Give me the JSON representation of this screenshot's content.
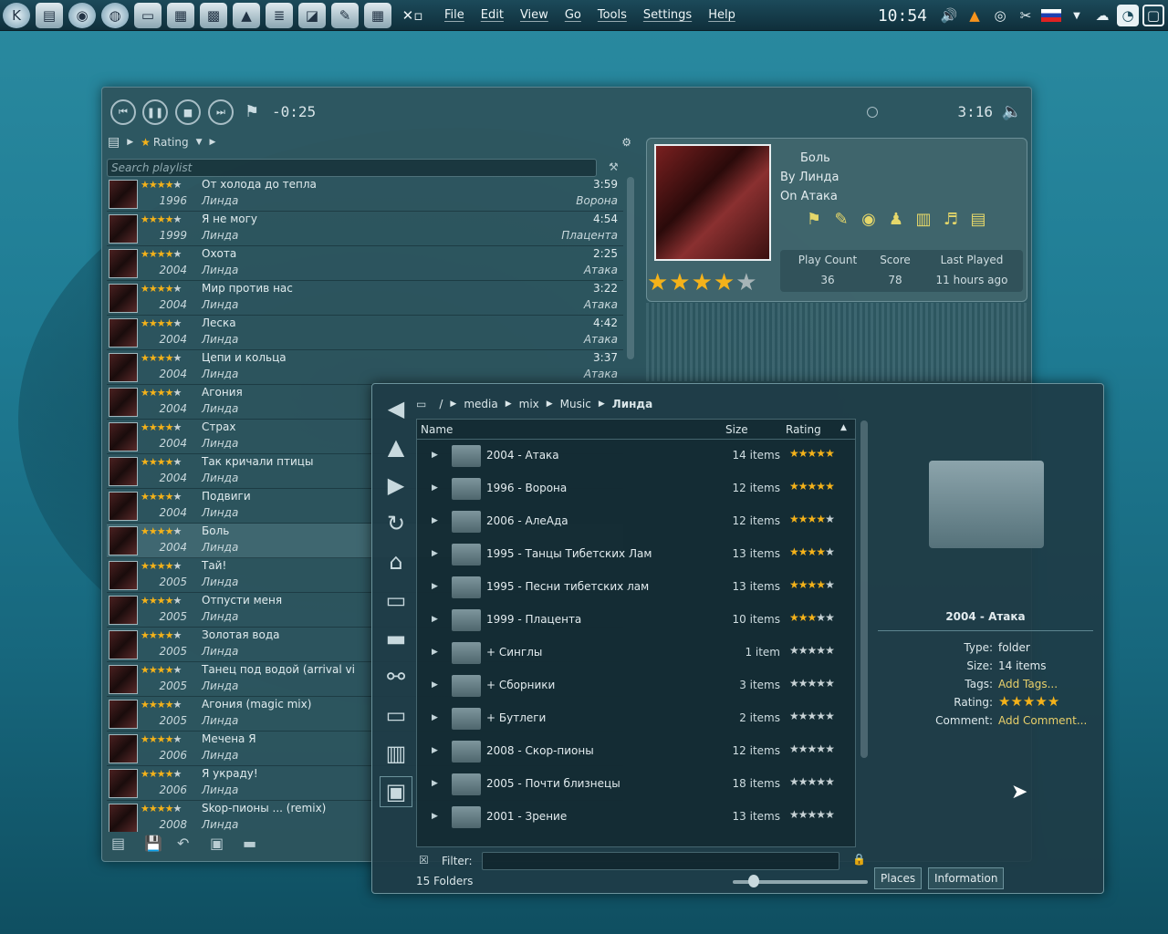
{
  "panel": {
    "menu": [
      "File",
      "Edit",
      "View",
      "Go",
      "Tools",
      "Settings",
      "Help"
    ],
    "clock": "10:54"
  },
  "player": {
    "elapsed": "-0:25",
    "total": "3:16",
    "rating_label": "Rating",
    "search_placeholder": "Search playlist"
  },
  "playlist": [
    {
      "title": "От холода до тепла",
      "dur": "3:59",
      "year": "1996",
      "artist": "Линда",
      "album": "Ворона",
      "stars": 4
    },
    {
      "title": "Я не могу",
      "dur": "4:54",
      "year": "1999",
      "artist": "Линда",
      "album": "Плацента",
      "stars": 4
    },
    {
      "title": "Охота",
      "dur": "2:25",
      "year": "2004",
      "artist": "Линда",
      "album": "Атака",
      "stars": 4
    },
    {
      "title": "Мир против нас",
      "dur": "3:22",
      "year": "2004",
      "artist": "Линда",
      "album": "Атака",
      "stars": 4
    },
    {
      "title": "Леска",
      "dur": "4:42",
      "year": "2004",
      "artist": "Линда",
      "album": "Атака",
      "stars": 4
    },
    {
      "title": "Цепи и кольца",
      "dur": "3:37",
      "year": "2004",
      "artist": "Линда",
      "album": "Атака",
      "stars": 4
    },
    {
      "title": "Агония",
      "dur": "",
      "year": "2004",
      "artist": "Линда",
      "album": "",
      "stars": 4
    },
    {
      "title": "Страх",
      "dur": "",
      "year": "2004",
      "artist": "Линда",
      "album": "",
      "stars": 4
    },
    {
      "title": "Так кричали птицы",
      "dur": "",
      "year": "2004",
      "artist": "Линда",
      "album": "",
      "stars": 4
    },
    {
      "title": "Подвиги",
      "dur": "",
      "year": "2004",
      "artist": "Линда",
      "album": "",
      "stars": 4
    },
    {
      "title": "Боль",
      "dur": "",
      "year": "2004",
      "artist": "Линда",
      "album": "",
      "stars": 4
    },
    {
      "title": "Тай!",
      "dur": "",
      "year": "2005",
      "artist": "Линда",
      "album": "",
      "stars": 4
    },
    {
      "title": "Отпусти меня",
      "dur": "",
      "year": "2005",
      "artist": "Линда",
      "album": "",
      "stars": 4
    },
    {
      "title": "Золотая вода",
      "dur": "",
      "year": "2005",
      "artist": "Линда",
      "album": "",
      "stars": 4
    },
    {
      "title": "Танец под водой (arrival vi",
      "dur": "",
      "year": "2005",
      "artist": "Линда",
      "album": "",
      "stars": 4
    },
    {
      "title": "Агония (magic mix)",
      "dur": "",
      "year": "2005",
      "artist": "Линда",
      "album": "",
      "stars": 4
    },
    {
      "title": "Мечена Я",
      "dur": "",
      "year": "2006",
      "artist": "Линда",
      "album": "",
      "stars": 4
    },
    {
      "title": "Я украду!",
      "dur": "",
      "year": "2006",
      "artist": "Линда",
      "album": "",
      "stars": 4
    },
    {
      "title": "Skop-пионы ... (remix)",
      "dur": "",
      "year": "2008",
      "artist": "Линда",
      "album": "",
      "stars": 4
    }
  ],
  "current": {
    "title": "Боль",
    "by": "By Линда",
    "on": "On Атака",
    "stars": 4,
    "stats": {
      "play_count_label": "Play Count",
      "score_label": "Score",
      "last_played_label": "Last Played",
      "play_count": "36",
      "score": "78",
      "last_played": "11 hours ago"
    }
  },
  "dolphin": {
    "path": [
      "/",
      "media",
      "mix",
      "Music",
      "Линда"
    ],
    "columns": {
      "name": "Name",
      "size": "Size",
      "rating": "Rating"
    },
    "folders": [
      {
        "name": "2004 - Атака",
        "size": "14 items",
        "stars": 5
      },
      {
        "name": "1996 - Ворона",
        "size": "12 items",
        "stars": 5
      },
      {
        "name": "2006 - АлеАда",
        "size": "12 items",
        "stars": 4
      },
      {
        "name": "1995 - Танцы Тибетских Лам",
        "size": "13 items",
        "stars": 4
      },
      {
        "name": "1995 - Песни тибетских лам",
        "size": "13 items",
        "stars": 4
      },
      {
        "name": "1999 - Плацента",
        "size": "10 items",
        "stars": 3
      },
      {
        "name": "+ Синглы",
        "size": "1 item",
        "stars": 0
      },
      {
        "name": "+ Сборники",
        "size": "3 items",
        "stars": 0
      },
      {
        "name": "+ Бутлеги",
        "size": "2 items",
        "stars": 0
      },
      {
        "name": "2008 - Скор-пионы",
        "size": "12 items",
        "stars": 0
      },
      {
        "name": "2005 - Почти близнецы",
        "size": "18 items",
        "stars": 0
      },
      {
        "name": "2001 - Зрение",
        "size": "13 items",
        "stars": 0
      }
    ],
    "filter_label": "Filter:",
    "count": "15 Folders",
    "tabs": {
      "places": "Places",
      "information": "Information"
    },
    "info": {
      "title": "2004 - Атака",
      "type_label": "Type:",
      "type": "folder",
      "size_label": "Size:",
      "size": "14 items",
      "tags_label": "Tags:",
      "tags": "Add Tags...",
      "rating_label": "Rating:",
      "comment_label": "Comment:",
      "comment": "Add Comment...",
      "stars": 5
    }
  }
}
